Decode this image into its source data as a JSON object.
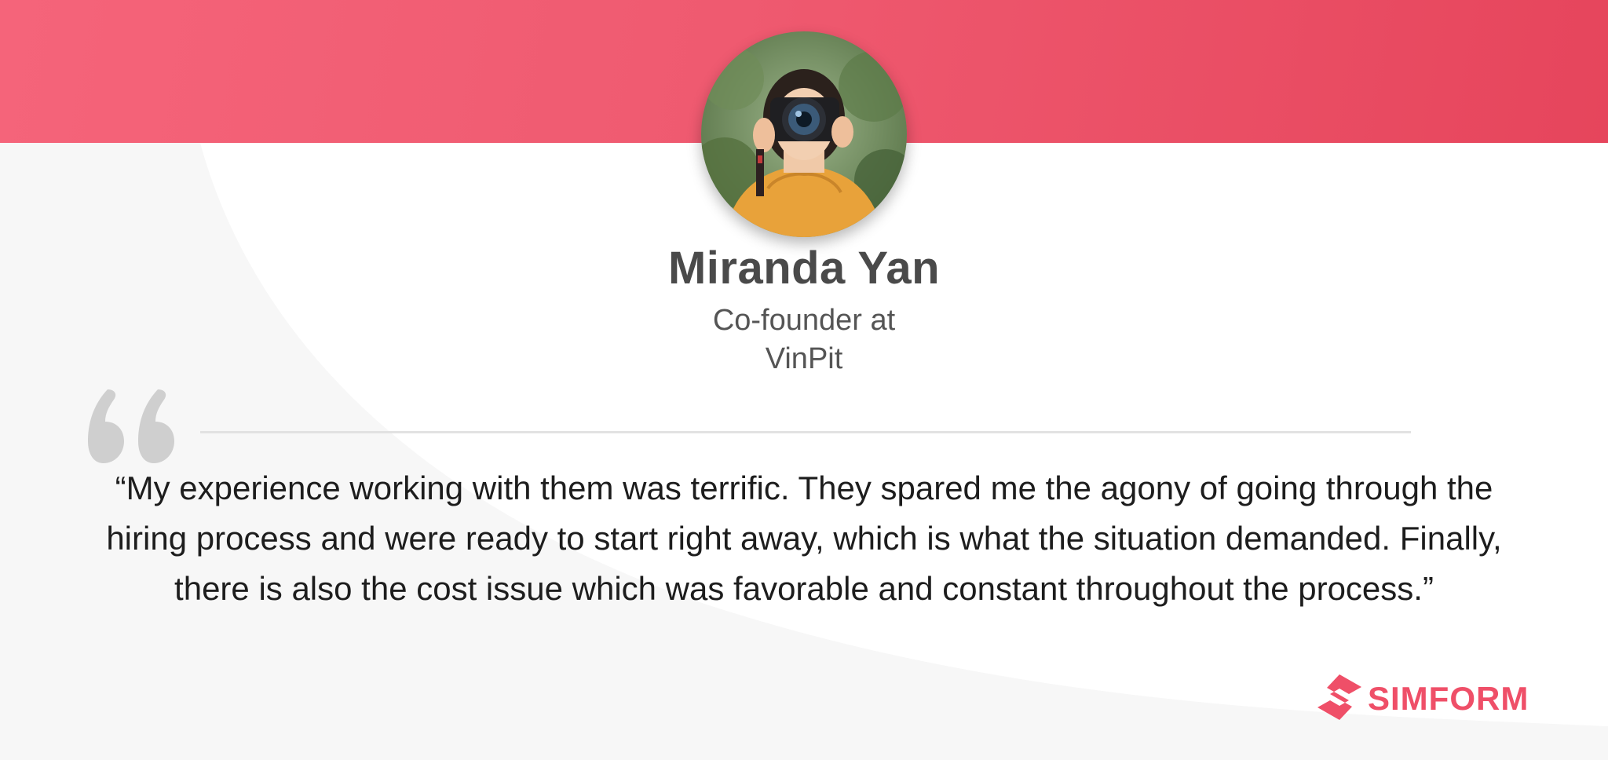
{
  "header": {
    "accent_color": "#ef5a70"
  },
  "profile": {
    "avatar_icon": "photographer-avatar",
    "name": "Miranda Yan",
    "role_line1": "Co-founder at",
    "role_line2": "VinPit"
  },
  "testimonial": {
    "quote_icon": "quote-mark-icon",
    "text": "“My experience working with them was terrific. They spared me the agony of going through the hiring process and were ready to start right away, which is what the situation demanded. Finally, there is also the cost issue which was favorable and constant throughout the process.”"
  },
  "brand": {
    "name": "SIMFORM",
    "color": "#ef4f68",
    "logo_icon": "simform-logo-icon"
  }
}
